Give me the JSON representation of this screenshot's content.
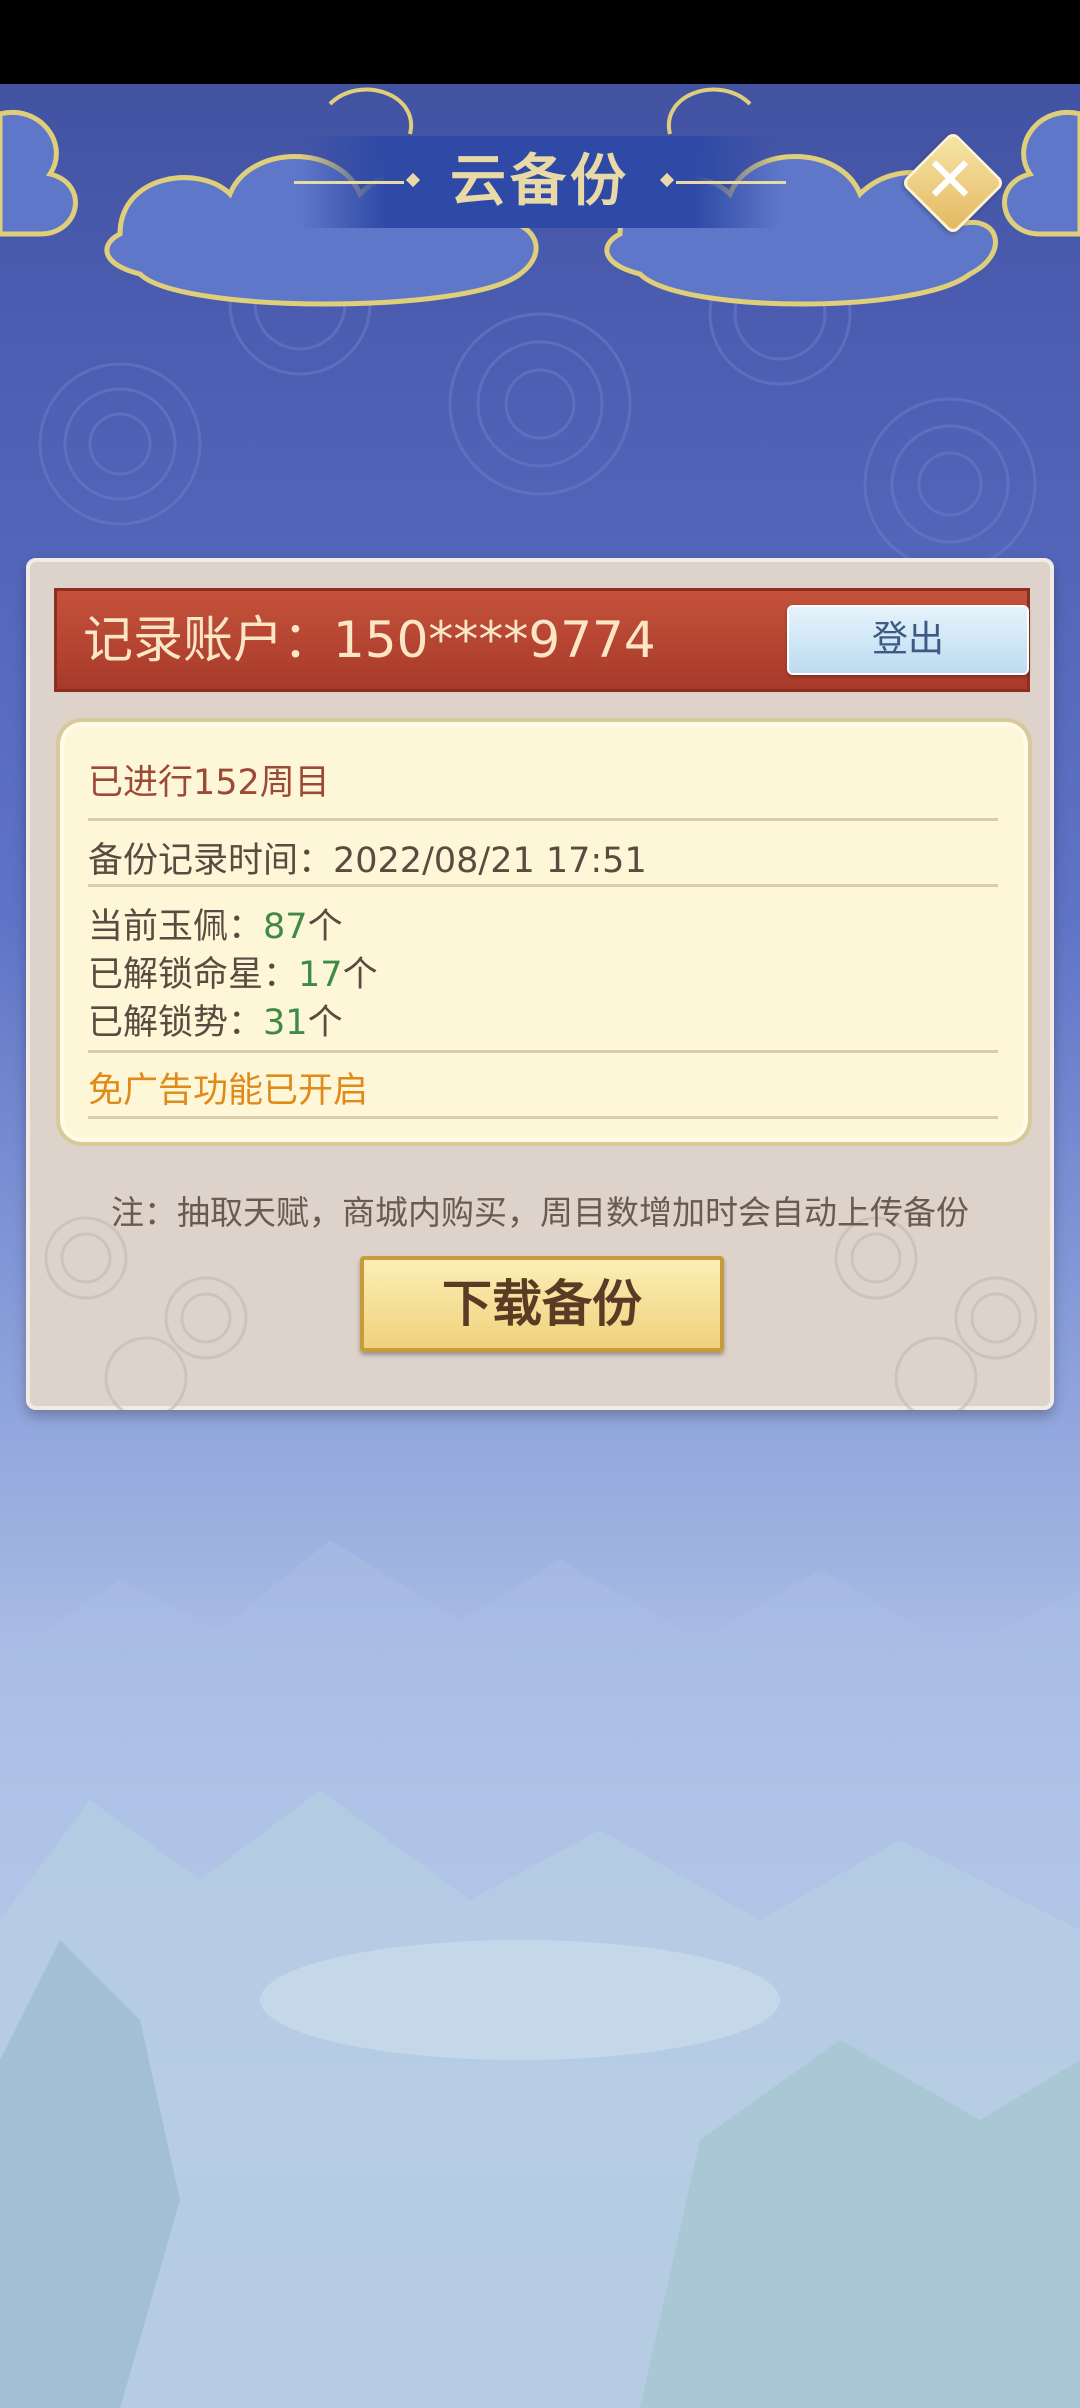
{
  "dialog": {
    "title": "云备份",
    "close_icon": "close-icon"
  },
  "account": {
    "label": "记录账户：150****9774",
    "logout_label": "登出"
  },
  "info": {
    "cycles": "已进行152周目",
    "backup_time": "备份记录时间：2022/08/21 17:51",
    "jade_label": "当前玉佩：",
    "jade_value": "87",
    "jade_unit": "个",
    "stars_label": "已解锁命星：",
    "stars_value": "17",
    "stars_unit": "个",
    "momentum_label": "已解锁势：",
    "momentum_value": "31",
    "momentum_unit": "个",
    "ad_free": "免广告功能已开启"
  },
  "note": "注：抽取天赋，商城内购买，周目数增加时会自动上传备份",
  "download_label": "下载备份",
  "colors": {
    "highlight_green": "#3f8a45",
    "highlight_orange": "#e08a1a",
    "account_bar": "#b4432f"
  }
}
